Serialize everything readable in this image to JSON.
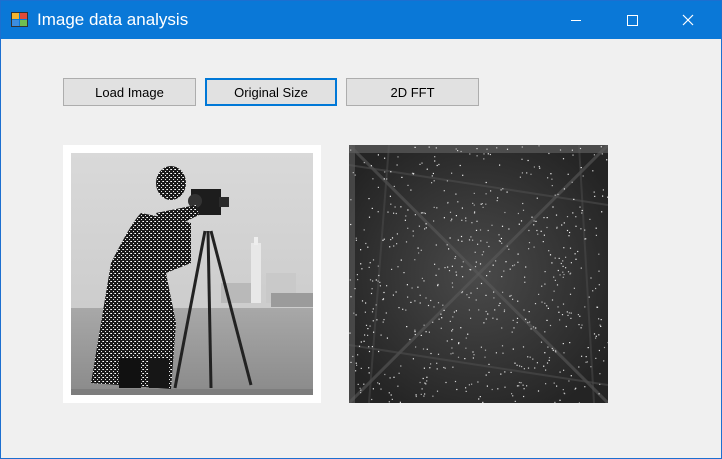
{
  "window": {
    "title": "Image data analysis",
    "icon": "app-icon",
    "titlebar_color": "#0a78d7"
  },
  "caption_buttons": {
    "minimize": "minimize-icon",
    "maximize": "maximize-icon",
    "close": "close-icon"
  },
  "toolbar": {
    "load_label": "Load Image",
    "original_size_label": "Original Size",
    "fft_label": "2D FFT",
    "focused_button": "Original Size",
    "focus_color": "#0078d7"
  },
  "images": {
    "left": "cameraman-photo",
    "right": "fft-spectrum"
  }
}
